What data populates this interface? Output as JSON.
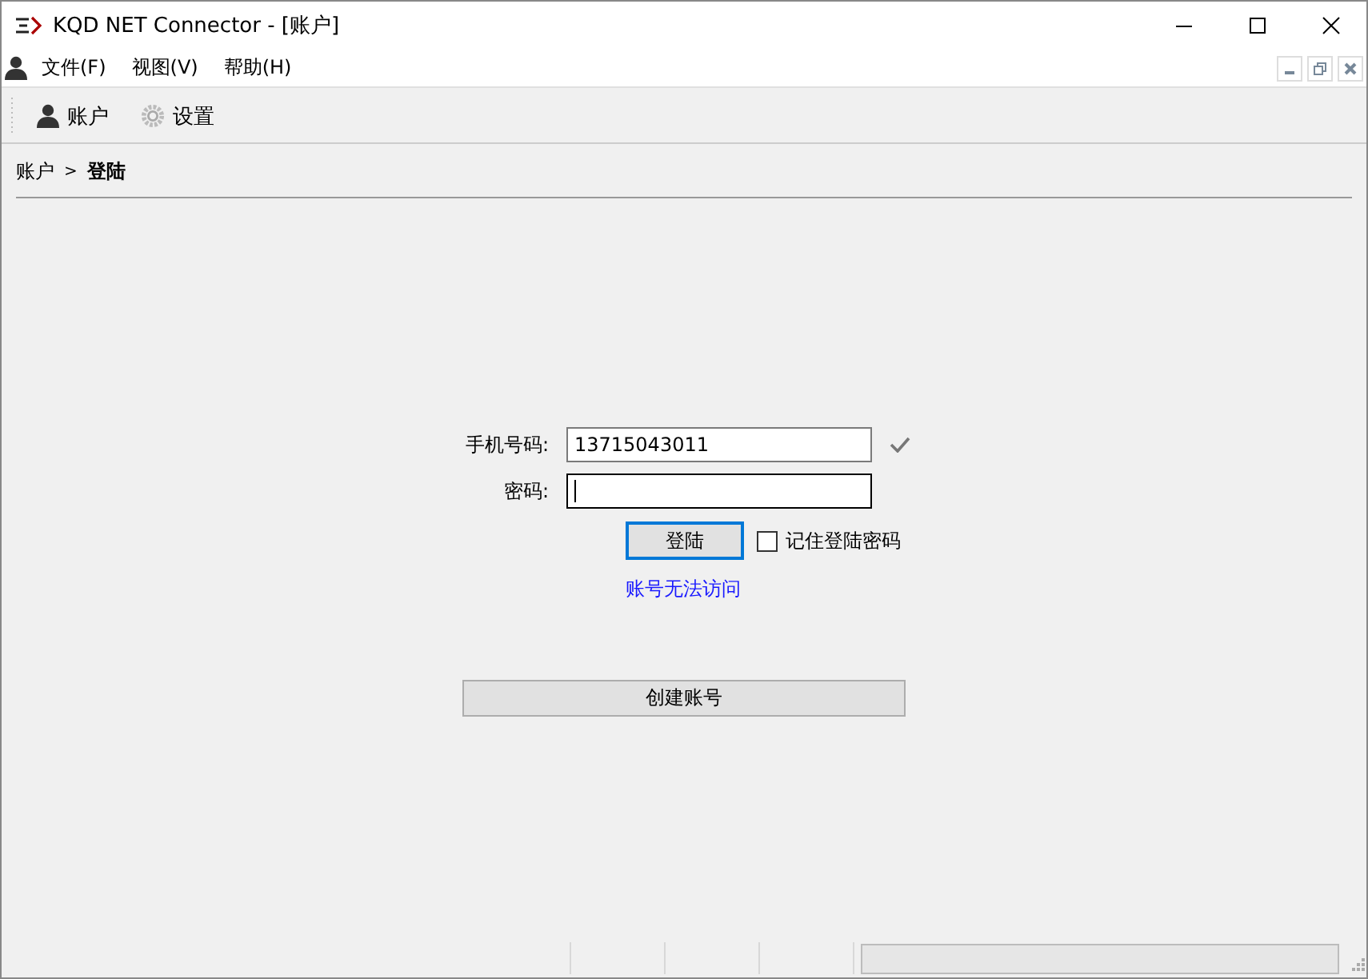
{
  "window": {
    "title": "KQD NET Connector - [账户]"
  },
  "menu": [
    "文件(F)",
    "视图(V)",
    "帮助(H)"
  ],
  "toolbar": [
    {
      "kind": "user",
      "label": "账户"
    },
    {
      "kind": "gear",
      "label": "设置"
    }
  ],
  "breadcrumb": {
    "parent": "账户",
    "separator": ">",
    "current": "登陆"
  },
  "form": {
    "phone": {
      "label": "手机号码:",
      "value": "13715043011",
      "valid": true
    },
    "password": {
      "label": "密码:",
      "focused": true
    },
    "login_button": "登陆",
    "remember": {
      "label": "记住登陆密码",
      "checked": false
    },
    "link": "账号无法访问",
    "create_button": "创建账号"
  },
  "status_bar": {
    "progress": {
      "level": 0
    }
  }
}
